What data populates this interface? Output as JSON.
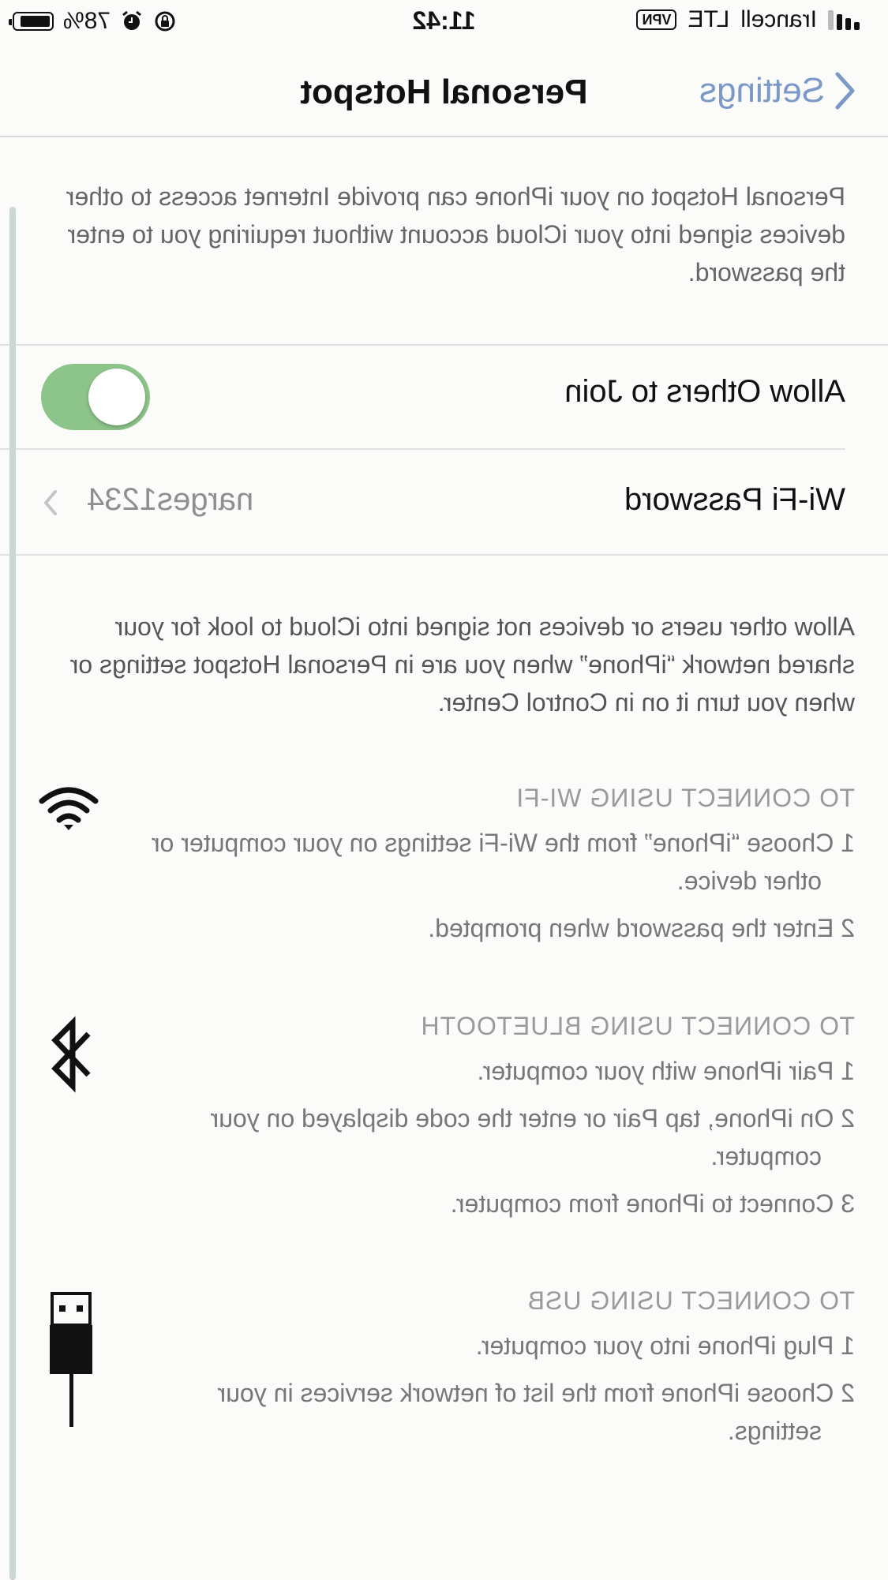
{
  "status": {
    "carrier": "Irancell",
    "network": "LTE",
    "vpn_label": "VPN",
    "time": "11:42",
    "battery": "78%"
  },
  "nav": {
    "back_label": "Settings",
    "title": "Personal Hotspot"
  },
  "intro_text": "Personal Hotspot on your iPhone can provide Internet access to other devices signed into your iCloud account without requiring you to enter the password.",
  "settings": {
    "allow_others_label": "Allow Others to Join",
    "allow_others_on": true,
    "wifi_password_label": "Wi-Fi Password",
    "wifi_password_value": "narges1234"
  },
  "allow_description": "Allow other users or devices not signed into iCloud to look for your shared network “iPhone” when you are in Personal Hotspot settings or when you turn it on in Control Center.",
  "sections": {
    "wifi": {
      "heading": "TO CONNECT USING WI-FI",
      "icon": "wifi-icon",
      "steps": [
        "1 Choose “iPhone” from the Wi-Fi settings on your computer or other device.",
        "2 Enter the password when prompted."
      ]
    },
    "bluetooth": {
      "heading": "TO CONNECT USING BLUETOOTH",
      "icon": "bluetooth-icon",
      "steps": [
        "1 Pair iPhone with your computer.",
        "2 On iPhone, tap Pair or enter the code displayed on your computer.",
        "3 Connect to iPhone from computer."
      ]
    },
    "usb": {
      "heading": "TO CONNECT USING USB",
      "icon": "usb-cable-icon",
      "steps": [
        "1 Plug iPhone into your computer.",
        "2 Choose iPhone from the list of network services in your settings."
      ]
    }
  },
  "colors": {
    "accent": "#7a99c6",
    "toggle_on": "#8cc48a"
  }
}
